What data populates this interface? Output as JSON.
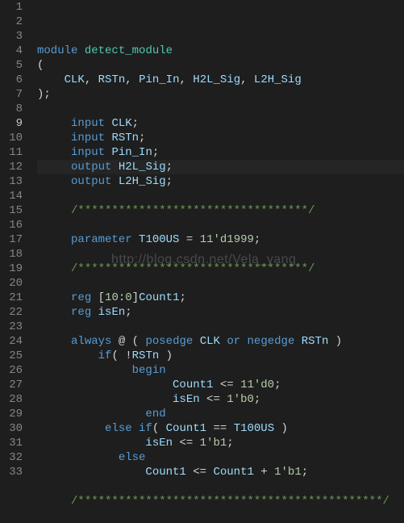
{
  "active_line_index": 8,
  "watermark": "http://blog.csdn.net/Vela_yang",
  "lines": [
    {
      "n": "1",
      "seg": [
        [
          "kw",
          "module"
        ],
        [
          "p",
          " "
        ],
        [
          "mod",
          "detect_module"
        ]
      ]
    },
    {
      "n": "2",
      "seg": [
        [
          "p",
          "("
        ]
      ]
    },
    {
      "n": "3",
      "seg": [
        [
          "p",
          "    "
        ],
        [
          "id",
          "CLK"
        ],
        [
          "c",
          ","
        ],
        [
          "p",
          " "
        ],
        [
          "id",
          "RSTn"
        ],
        [
          "c",
          ","
        ],
        [
          "p",
          " "
        ],
        [
          "id",
          "Pin_In"
        ],
        [
          "c",
          ","
        ],
        [
          "p",
          " "
        ],
        [
          "id",
          "H2L_Sig"
        ],
        [
          "c",
          ","
        ],
        [
          "p",
          " "
        ],
        [
          "id",
          "L2H_Sig"
        ]
      ]
    },
    {
      "n": "4",
      "seg": [
        [
          "p",
          ");"
        ]
      ]
    },
    {
      "n": "5",
      "seg": []
    },
    {
      "n": "6",
      "seg": [
        [
          "p",
          "     "
        ],
        [
          "type",
          "input"
        ],
        [
          "p",
          " "
        ],
        [
          "id",
          "CLK"
        ],
        [
          "c",
          ";"
        ]
      ]
    },
    {
      "n": "7",
      "seg": [
        [
          "p",
          "     "
        ],
        [
          "type",
          "input"
        ],
        [
          "p",
          " "
        ],
        [
          "id",
          "RSTn"
        ],
        [
          "c",
          ";"
        ]
      ]
    },
    {
      "n": "8",
      "seg": [
        [
          "p",
          "     "
        ],
        [
          "type",
          "input"
        ],
        [
          "p",
          " "
        ],
        [
          "id",
          "Pin_In"
        ],
        [
          "c",
          ";"
        ]
      ]
    },
    {
      "n": "9",
      "seg": [
        [
          "p",
          "     "
        ],
        [
          "type",
          "output"
        ],
        [
          "p",
          " "
        ],
        [
          "id",
          "H2L_Sig"
        ],
        [
          "c",
          ";"
        ]
      ]
    },
    {
      "n": "10",
      "seg": [
        [
          "p",
          "     "
        ],
        [
          "type",
          "output"
        ],
        [
          "p",
          " "
        ],
        [
          "id",
          "L2H_Sig"
        ],
        [
          "c",
          ";"
        ]
      ]
    },
    {
      "n": "11",
      "seg": []
    },
    {
      "n": "12",
      "seg": [
        [
          "p",
          "     "
        ],
        [
          "cmt",
          "/**********************************/"
        ]
      ]
    },
    {
      "n": "13",
      "seg": []
    },
    {
      "n": "14",
      "seg": [
        [
          "p",
          "     "
        ],
        [
          "kw",
          "parameter"
        ],
        [
          "p",
          " "
        ],
        [
          "id",
          "T100US"
        ],
        [
          "p",
          " "
        ],
        [
          "c",
          "="
        ],
        [
          "p",
          " "
        ],
        [
          "num",
          "11'd1999"
        ],
        [
          "c",
          ";"
        ]
      ]
    },
    {
      "n": "15",
      "seg": []
    },
    {
      "n": "16",
      "seg": [
        [
          "p",
          "     "
        ],
        [
          "cmt",
          "/**********************************/"
        ]
      ]
    },
    {
      "n": "17",
      "seg": []
    },
    {
      "n": "18",
      "seg": [
        [
          "p",
          "     "
        ],
        [
          "type",
          "reg"
        ],
        [
          "p",
          " "
        ],
        [
          "c",
          "["
        ],
        [
          "num",
          "10"
        ],
        [
          "c",
          ":"
        ],
        [
          "num",
          "0"
        ],
        [
          "c",
          "]"
        ],
        [
          "id",
          "Count1"
        ],
        [
          "c",
          ";"
        ]
      ]
    },
    {
      "n": "19",
      "seg": [
        [
          "p",
          "     "
        ],
        [
          "type",
          "reg"
        ],
        [
          "p",
          " "
        ],
        [
          "id",
          "isEn"
        ],
        [
          "c",
          ";"
        ]
      ]
    },
    {
      "n": "20",
      "seg": []
    },
    {
      "n": "21",
      "seg": [
        [
          "p",
          "     "
        ],
        [
          "kw",
          "always"
        ],
        [
          "p",
          " "
        ],
        [
          "c",
          "@"
        ],
        [
          "p",
          " ( "
        ],
        [
          "kw",
          "posedge"
        ],
        [
          "p",
          " "
        ],
        [
          "id",
          "CLK"
        ],
        [
          "p",
          " "
        ],
        [
          "kw",
          "or"
        ],
        [
          "p",
          " "
        ],
        [
          "kw",
          "negedge"
        ],
        [
          "p",
          " "
        ],
        [
          "id",
          "RSTn"
        ],
        [
          "p",
          " )"
        ]
      ]
    },
    {
      "n": "22",
      "seg": [
        [
          "p",
          "         "
        ],
        [
          "kw",
          "if"
        ],
        [
          "p",
          "( "
        ],
        [
          "c",
          "!"
        ],
        [
          "id",
          "RSTn"
        ],
        [
          "p",
          " )"
        ]
      ]
    },
    {
      "n": "23",
      "seg": [
        [
          "p",
          "              "
        ],
        [
          "kw",
          "begin"
        ]
      ]
    },
    {
      "n": "24",
      "seg": [
        [
          "p",
          "                    "
        ],
        [
          "id",
          "Count1"
        ],
        [
          "p",
          " "
        ],
        [
          "c",
          "<="
        ],
        [
          "p",
          " "
        ],
        [
          "num",
          "11'd0"
        ],
        [
          "c",
          ";"
        ]
      ]
    },
    {
      "n": "25",
      "seg": [
        [
          "p",
          "                    "
        ],
        [
          "id",
          "isEn"
        ],
        [
          "p",
          " "
        ],
        [
          "c",
          "<="
        ],
        [
          "p",
          " "
        ],
        [
          "num",
          "1'b0"
        ],
        [
          "c",
          ";"
        ]
      ]
    },
    {
      "n": "26",
      "seg": [
        [
          "p",
          "                "
        ],
        [
          "kw",
          "end"
        ]
      ]
    },
    {
      "n": "27",
      "seg": [
        [
          "p",
          "          "
        ],
        [
          "kw",
          "else"
        ],
        [
          "p",
          " "
        ],
        [
          "kw",
          "if"
        ],
        [
          "p",
          "( "
        ],
        [
          "id",
          "Count1"
        ],
        [
          "p",
          " "
        ],
        [
          "c",
          "=="
        ],
        [
          "p",
          " "
        ],
        [
          "id",
          "T100US"
        ],
        [
          "p",
          " )"
        ]
      ]
    },
    {
      "n": "28",
      "seg": [
        [
          "p",
          "                "
        ],
        [
          "id",
          "isEn"
        ],
        [
          "p",
          " "
        ],
        [
          "c",
          "<="
        ],
        [
          "p",
          " "
        ],
        [
          "num",
          "1'b1"
        ],
        [
          "c",
          ";"
        ]
      ]
    },
    {
      "n": "29",
      "seg": [
        [
          "p",
          "            "
        ],
        [
          "kw",
          "else"
        ]
      ]
    },
    {
      "n": "30",
      "seg": [
        [
          "p",
          "                "
        ],
        [
          "id",
          "Count1"
        ],
        [
          "p",
          " "
        ],
        [
          "c",
          "<="
        ],
        [
          "p",
          " "
        ],
        [
          "id",
          "Count1"
        ],
        [
          "p",
          " "
        ],
        [
          "c",
          "+"
        ],
        [
          "p",
          " "
        ],
        [
          "num",
          "1'b1"
        ],
        [
          "c",
          ";"
        ]
      ]
    },
    {
      "n": "31",
      "seg": []
    },
    {
      "n": "32",
      "seg": [
        [
          "p",
          "     "
        ],
        [
          "cmt",
          "/*********************************************/"
        ]
      ]
    },
    {
      "n": "33",
      "seg": []
    }
  ]
}
